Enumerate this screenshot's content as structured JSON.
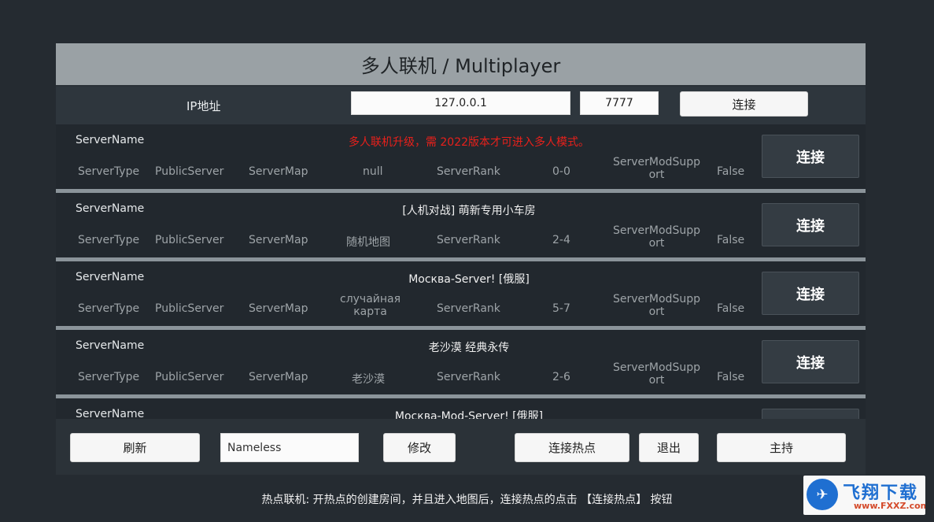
{
  "title": "多人联机 / Multiplayer",
  "ip_row": {
    "label": "IP地址",
    "ip_value": "127.0.0.1",
    "port_value": "7777",
    "connect_label": "连接"
  },
  "servers": [
    {
      "name_label": "ServerName",
      "title": "多人联机升级，需 2022版本才可进入多人模式。",
      "type_label": "ServerType",
      "type_value": "PublicServer",
      "map_label": "ServerMap",
      "map_value": "null",
      "rank_label": "ServerRank",
      "rank_value": "0-0",
      "mod_label_1": "ServerModSupp",
      "mod_label_2": "ort",
      "mod_value": "False",
      "connect_label": "连接"
    },
    {
      "name_label": "ServerName",
      "title": "[人机对战] 萌新专用小车房",
      "type_label": "ServerType",
      "type_value": "PublicServer",
      "map_label": "ServerMap",
      "map_value": "随机地图",
      "rank_label": "ServerRank",
      "rank_value": "2-4",
      "mod_label_1": "ServerModSupp",
      "mod_label_2": "ort",
      "mod_value": "False",
      "connect_label": "连接"
    },
    {
      "name_label": "ServerName",
      "title": "Москва-Server! [俄服]",
      "type_label": "ServerType",
      "type_value": "PublicServer",
      "map_label": "ServerMap",
      "map_value_1": "случайная",
      "map_value_2": "карта",
      "rank_label": "ServerRank",
      "rank_value": "5-7",
      "mod_label_1": "ServerModSupp",
      "mod_label_2": "ort",
      "mod_value": "False",
      "connect_label": "连接"
    },
    {
      "name_label": "ServerName",
      "title": "老沙漠 经典永传",
      "type_label": "ServerType",
      "type_value": "PublicServer",
      "map_label": "ServerMap",
      "map_value": "老沙漠",
      "rank_label": "ServerRank",
      "rank_value": "2-6",
      "mod_label_1": "ServerModSupp",
      "mod_label_2": "ort",
      "mod_value": "False",
      "connect_label": "连接"
    },
    {
      "name_label": "ServerName",
      "title": "Москва-Mod-Server! [俄服]"
    }
  ],
  "bottom": {
    "refresh_label": "刷新",
    "name_value": "Nameless",
    "modify_label": "修改",
    "hotspot_label": "连接热点",
    "exit_label": "退出",
    "host_label": "主持"
  },
  "hint": "热点联机: 开热点的创建房间，并且进入地图后，连接热点的点击 【连接热点】 按钮",
  "watermark": {
    "brand": "飞翔下载",
    "url": "www.FXXZ.com"
  }
}
